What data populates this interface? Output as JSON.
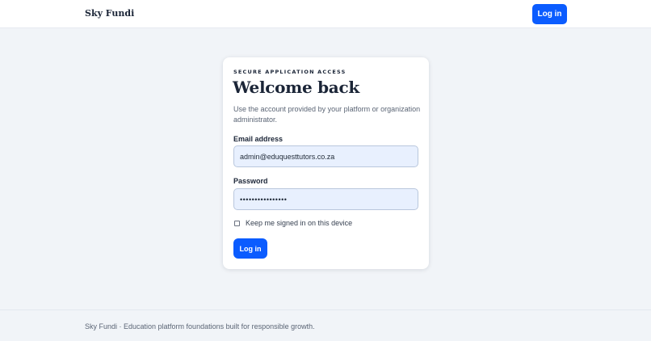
{
  "header": {
    "brand": "Sky Fundi",
    "login_label": "Log in"
  },
  "card": {
    "eyebrow": "SECURE APPLICATION ACCESS",
    "title": "Welcome back",
    "subtitle": "Use the account provided by your platform or organization administrator.",
    "email": {
      "label": "Email address",
      "value": "admin@eduquesttutors.co.za"
    },
    "password": {
      "label": "Password",
      "value": "••••••••••••••••"
    },
    "remember": {
      "label": "Keep me signed in on this device",
      "checked": false
    },
    "submit_label": "Log in"
  },
  "footer": {
    "text": "Sky Fundi · Education platform foundations built for responsible growth."
  }
}
